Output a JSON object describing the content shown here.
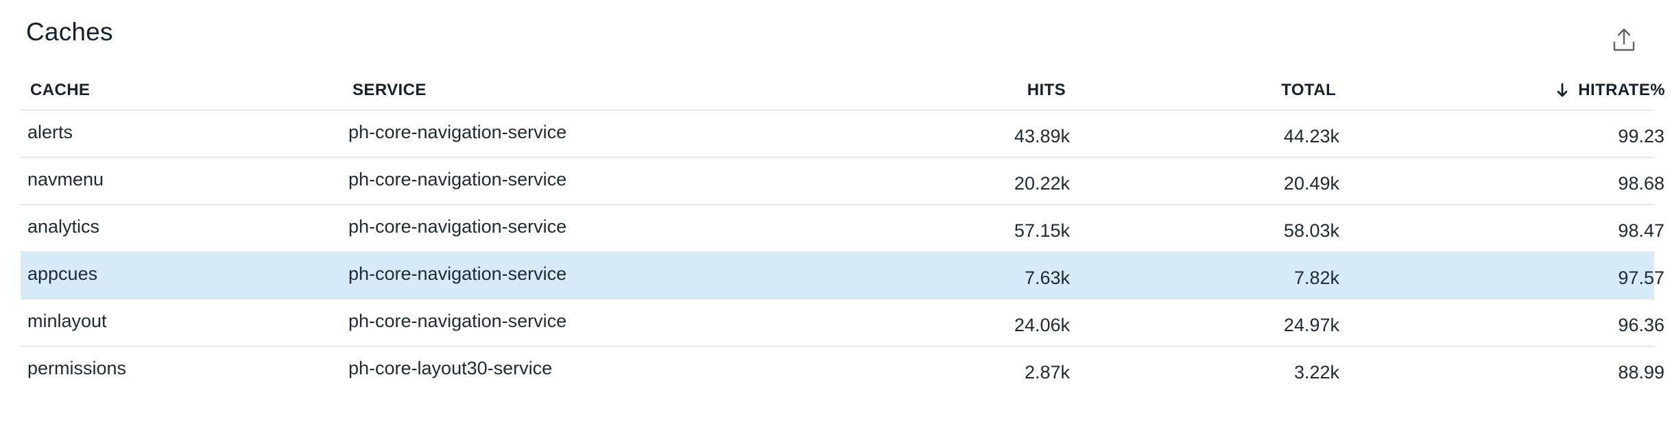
{
  "panel": {
    "title": "Caches",
    "export_icon": "export-icon"
  },
  "table": {
    "columns": {
      "cache": "CACHE",
      "service": "SERVICE",
      "hits": "HITS",
      "total": "TOTAL",
      "hitrate": "HITRATE%"
    },
    "sort": {
      "column": "hitrate",
      "direction": "descending",
      "icon": "arrow-down-icon"
    },
    "selected_row": 3,
    "highlight_color": "#d6eaf7",
    "rows": [
      {
        "cache": "alerts",
        "service": "ph-core-navigation-service",
        "hits": "43.89k",
        "total": "44.23k",
        "hitrate": "99.23"
      },
      {
        "cache": "navmenu",
        "service": "ph-core-navigation-service",
        "hits": "20.22k",
        "total": "20.49k",
        "hitrate": "98.68"
      },
      {
        "cache": "analytics",
        "service": "ph-core-navigation-service",
        "hits": "57.15k",
        "total": "58.03k",
        "hitrate": "98.47"
      },
      {
        "cache": "appcues",
        "service": "ph-core-navigation-service",
        "hits": "7.63k",
        "total": "7.82k",
        "hitrate": "97.57"
      },
      {
        "cache": "minlayout",
        "service": "ph-core-navigation-service",
        "hits": "24.06k",
        "total": "24.97k",
        "hitrate": "96.36"
      },
      {
        "cache": "permissions",
        "service": "ph-core-layout30-service",
        "hits": "2.87k",
        "total": "3.22k",
        "hitrate": "88.99"
      }
    ]
  }
}
